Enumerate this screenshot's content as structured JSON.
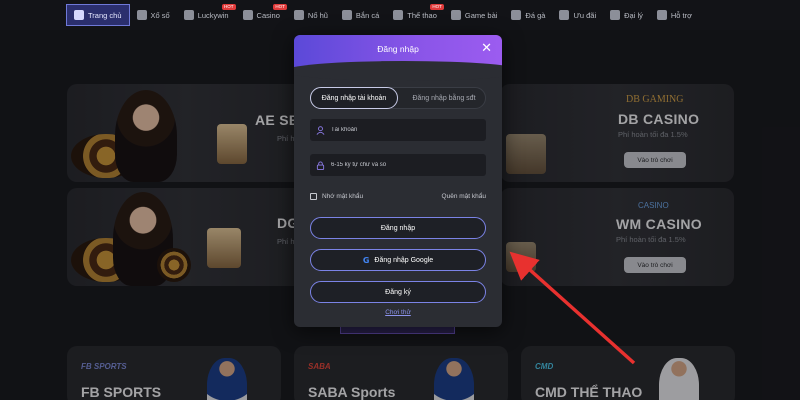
{
  "nav": {
    "items": [
      {
        "label": "Trang chủ",
        "icon": "home-icon",
        "active": true
      },
      {
        "label": "Xổ số",
        "icon": "lottery-icon"
      },
      {
        "label": "Luckywin",
        "icon": "luckywin-icon",
        "badge": "HOT"
      },
      {
        "label": "Casino",
        "icon": "casino-icon",
        "badge": "HOT"
      },
      {
        "label": "Nổ hũ",
        "icon": "slot-icon"
      },
      {
        "label": "Bắn cá",
        "icon": "fish-icon"
      },
      {
        "label": "Thể thao",
        "icon": "sport-icon",
        "badge": "HOT"
      },
      {
        "label": "Game bài",
        "icon": "card-game-icon"
      },
      {
        "label": "Đá gà",
        "icon": "cockfight-icon"
      },
      {
        "label": "Ưu đãi",
        "icon": "promo-icon"
      },
      {
        "label": "Đại lý",
        "icon": "agent-icon"
      },
      {
        "label": "Hỗ trợ",
        "icon": "support-icon"
      }
    ]
  },
  "casino_cards": [
    {
      "name": "AE SE",
      "sub": "Phí h"
    },
    {
      "name": "DB CASINO",
      "sub": "Phí hoàn tối đa 1.5%",
      "logo": "DB GAMING",
      "button": "Vào trò chơi"
    },
    {
      "name": "DG",
      "sub": "Phí h"
    },
    {
      "name": "WM CASINO",
      "sub": "Phí hoàn tối đa 1.5%",
      "logo": "CASINO",
      "button": "Vào trò chơi"
    }
  ],
  "sports": [
    {
      "name": "FB SPORTS",
      "logo": "FB SPORTS"
    },
    {
      "name": "SABA Sports",
      "logo": "SABA"
    },
    {
      "name": "CMD THỂ THAO",
      "logo": "CMD"
    }
  ],
  "modal": {
    "title": "Đăng nhập",
    "tab_account": "Đăng nhập tài khoản",
    "tab_quick": "Đăng nhập bằng sđt",
    "username_placeholder": "Tài khoản",
    "password_placeholder": "6-15 ký tự chữ và số",
    "remember_label": "Nhớ mật khẩu",
    "forgot_label": "Quên mật khẩu",
    "login_button": "Đăng nhập",
    "google_button": "Đăng nhập Google",
    "google_letter": "G",
    "register_button": "Đăng ký",
    "try_link": "Chơi thử"
  },
  "colors": {
    "accent": "#7b83e6",
    "header_gradient_start": "#5b49d8",
    "header_gradient_end": "#9c5cf0",
    "arrow": "#e8312f"
  }
}
